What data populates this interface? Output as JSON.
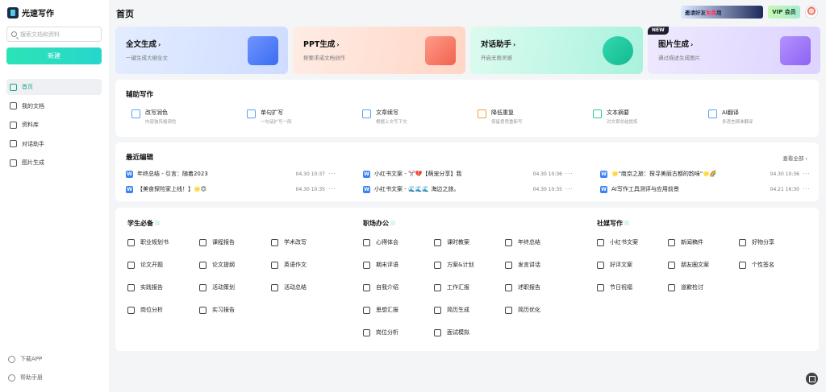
{
  "brand": {
    "name": "光速写作"
  },
  "sidebar": {
    "search_placeholder": "搜索文档和资料",
    "new_button": "新建",
    "items": [
      {
        "label": "首页",
        "icon": "home-icon",
        "active": true
      },
      {
        "label": "我的文档",
        "icon": "document-icon",
        "active": false
      },
      {
        "label": "资料库",
        "icon": "library-icon",
        "active": false
      },
      {
        "label": "对话助手",
        "icon": "chat-icon",
        "active": false
      },
      {
        "label": "图片生成",
        "icon": "image-icon",
        "active": false
      }
    ],
    "download_app": "下载APP",
    "help_manual": "帮助手册"
  },
  "header": {
    "title": "首页",
    "invite_text": "邀请好友",
    "invite_free": "免费",
    "invite_suffix": "用",
    "vip_label": "VIP 会员"
  },
  "feature_cards": [
    {
      "title": "全文生成",
      "subtitle": "一键生成大纲全文",
      "icon": "word-doc-icon"
    },
    {
      "title": "PPT生成",
      "subtitle": "按要求或文档创作",
      "icon": "presentation-icon"
    },
    {
      "title": "对话助手",
      "subtitle": "开启无限灵感",
      "icon": "ai-chat-icon"
    },
    {
      "title": "图片生成",
      "subtitle": "通过描述生成图片",
      "icon": "image-gen-icon",
      "tag": "NEW"
    }
  ],
  "assist": {
    "title": "辅助写作",
    "tools": [
      {
        "name": "改写润色",
        "desc": "内容独风格调色",
        "icon": "polish-icon"
      },
      {
        "name": "单句扩写",
        "desc": "一句话扩写一段",
        "icon": "expand-icon"
      },
      {
        "name": "文章续写",
        "desc": "根据上文写下文",
        "icon": "continue-icon"
      },
      {
        "name": "降低重复",
        "desc": "保留意思重新写",
        "icon": "dedupe-icon"
      },
      {
        "name": "文本摘要",
        "desc": "对文章总结提炼",
        "icon": "summary-icon"
      },
      {
        "name": "AI翻译",
        "desc": "多语言精准翻译",
        "icon": "translate-icon"
      }
    ]
  },
  "recent": {
    "title": "最近编辑",
    "view_all": "查看全部",
    "items": [
      {
        "title": "年终总结 - 引言：随着2023",
        "time": "04.30 10:37"
      },
      {
        "title": "小红书文案 - ✂️💔【萌宠分享】我",
        "time": "04.30 10:36"
      },
      {
        "title": "🌟\"南京之旅：探寻美丽古都的韵味\"🌟🌈",
        "time": "04.30 10:36"
      },
      {
        "title": "【美食探险家上线！】🌟😊",
        "time": "04.30 10:35"
      },
      {
        "title": "小红书文案 - 🌊🌊🌊 海边之旅。",
        "time": "04.30 10:35"
      },
      {
        "title": "AI写作工具测评与应用前景",
        "time": "04.21 16:30"
      }
    ]
  },
  "categories": [
    {
      "title": "学生必备",
      "items": [
        "职业规划书",
        "课程报告",
        "学术改写",
        "论文开题",
        "论文提纲",
        "英语作文",
        "实践报告",
        "活动策划",
        "活动总结",
        "岗位分析",
        "实习报告"
      ]
    },
    {
      "title": "职场办公",
      "items": [
        "心得体会",
        "课时教案",
        "年终总结",
        "期末评语",
        "方案&计划",
        "发言讲话",
        "自我介绍",
        "工作汇报",
        "述职报告",
        "思想汇报",
        "简历生成",
        "简历优化",
        "岗位分析",
        "面试模拟"
      ]
    },
    {
      "title": "社媒写作",
      "items": [
        "小红书文案",
        "新闻稿件",
        "好物分享",
        "好评文案",
        "朋友圈文案",
        "个性签名",
        "节日祝福",
        "道歉检讨"
      ]
    }
  ]
}
